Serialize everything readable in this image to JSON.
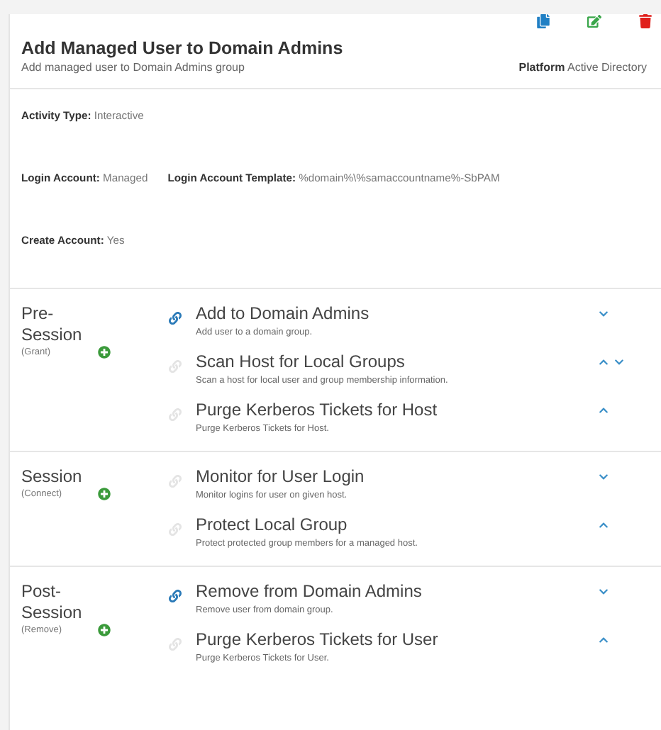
{
  "header": {
    "title": "Add Managed User to Domain Admins",
    "description": "Add managed user to Domain Admins group",
    "platform_label": "Platform",
    "platform": "Active Directory"
  },
  "details": [
    {
      "label": "Activity Type:",
      "value": "Interactive"
    },
    {
      "label": "Login Account:",
      "value": "Managed"
    },
    {
      "label": "Login Account Template:",
      "value": "%domain%\\%samaccountname%-SbPAM"
    },
    {
      "label": "Create Account:",
      "value": "Yes"
    }
  ],
  "sections": [
    {
      "name": "Pre-Session",
      "subtitle": "(Grant)",
      "activities": [
        {
          "title": "Add to Domain Admins",
          "description": "Add user to a domain group.",
          "linked": true,
          "move_up": false,
          "move_down": true
        },
        {
          "title": "Scan Host for Local Groups",
          "description": "Scan a host for local user and group membership information.",
          "linked": false,
          "move_up": true,
          "move_down": true
        },
        {
          "title": "Purge Kerberos Tickets for Host",
          "description": "Purge Kerberos Tickets for Host.",
          "linked": false,
          "move_up": true,
          "move_down": false
        }
      ]
    },
    {
      "name": "Session",
      "subtitle": "(Connect)",
      "activities": [
        {
          "title": "Monitor for User Login",
          "description": "Monitor logins for user on given host.",
          "linked": false,
          "move_up": false,
          "move_down": true
        },
        {
          "title": "Protect Local Group",
          "description": "Protect protected group members for a managed host.",
          "linked": false,
          "move_up": true,
          "move_down": false
        }
      ]
    },
    {
      "name": "Post-Session",
      "subtitle": "(Remove)",
      "activities": [
        {
          "title": "Remove from Domain Admins",
          "description": "Remove user from domain group.",
          "linked": true,
          "move_up": false,
          "move_down": true
        },
        {
          "title": "Purge Kerberos Tickets for User",
          "description": "Purge Kerberos Tickets for User.",
          "linked": false,
          "move_up": true,
          "move_down": false
        }
      ]
    }
  ]
}
